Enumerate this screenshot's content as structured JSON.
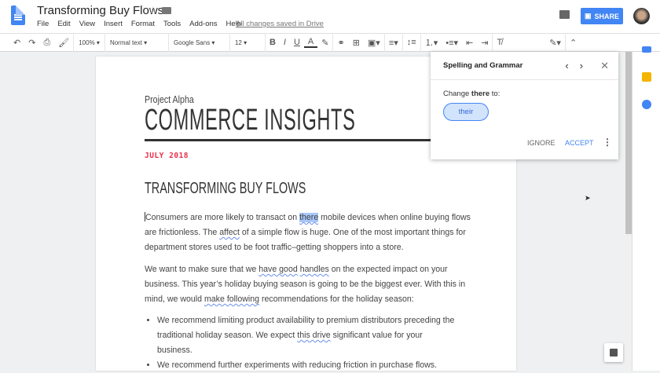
{
  "header": {
    "title": "Transforming Buy Flows",
    "menu": [
      "File",
      "Edit",
      "View",
      "Insert",
      "Format",
      "Tools",
      "Add-ons",
      "Help"
    ],
    "saved_status": "All changes saved in Drive",
    "share_label": "SHARE"
  },
  "toolbar": {
    "zoom": "100%",
    "style": "Normal text",
    "font": "Google Sans",
    "size": "12"
  },
  "document": {
    "kicker": "Project Alpha",
    "title": "COMMERCE INSIGHTS",
    "date": "JULY 2018",
    "heading": "TRANSFORMING BUY FLOWS",
    "p1": [
      "Consumers are more likely to transact on ",
      "there",
      " mobile devices when online buying flows are frictionless. The ",
      "affect",
      " of a simple flow is huge. One of the most important things for department stores used to be foot traffic–getting shoppers into a store."
    ],
    "p2": [
      "We want to make sure that we ",
      "have good",
      " ",
      "handles",
      " on the expected impact on your business. This year’s holiday buying season is going to be the biggest ever. With this in mind, we would ",
      "make following",
      " recommendations for the holiday season:"
    ],
    "b1": [
      "We recommend limiting product availability to premium distributors preceding the traditional holiday season. We expect ",
      "this drive",
      " significant value for your business."
    ],
    "b2": "We recommend further experiments with reducing friction in purchase flows."
  },
  "spelling": {
    "title": "Spelling and Grammar",
    "prompt_pre": "Change ",
    "word": "there",
    "prompt_post": " to:",
    "suggestion": "their",
    "ignore": "IGNORE",
    "accept": "ACCEPT"
  },
  "colors": {
    "accent": "#4285f4",
    "date": "#e8304a"
  }
}
